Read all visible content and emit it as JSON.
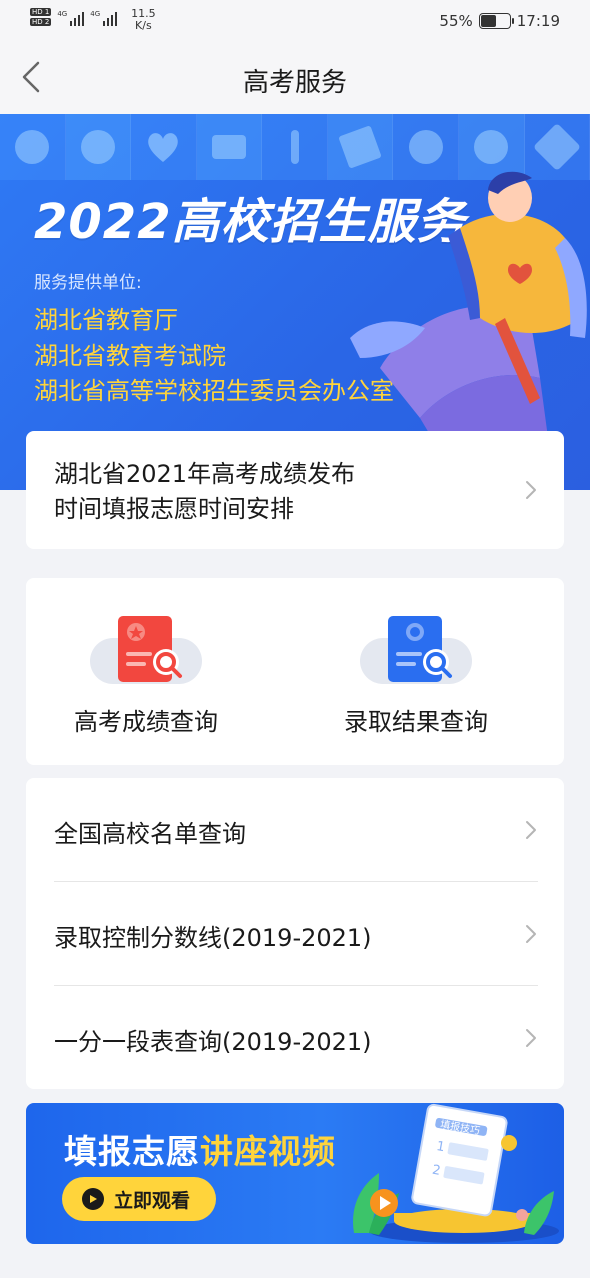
{
  "status_bar": {
    "sim1": "HD 1",
    "sim2": "HD 2",
    "network1": "4G",
    "network2": "4G",
    "speed_value": "11.5",
    "speed_unit": "K/s",
    "battery": "55%",
    "time": "17:19"
  },
  "nav": {
    "title": "高考服务",
    "back_icon": "chevron-left-icon"
  },
  "banner": {
    "title": "2022高校招生服务",
    "subtitle": "服务提供单位:",
    "providers": [
      "湖北省教育厅",
      "湖北省教育考试院",
      "湖北省高等学校招生委员会办公室"
    ],
    "colors": {
      "background": "#2a6ef0",
      "highlight": "#ffd43b"
    }
  },
  "notice": {
    "line1": "湖北省2021年高考成绩发布",
    "line2": "时间填报志愿时间安排"
  },
  "quick": {
    "items": [
      {
        "label": "高考成绩查询",
        "icon": "score-report-icon",
        "color": "#f2473f"
      },
      {
        "label": "录取结果查询",
        "icon": "admission-certificate-icon",
        "color": "#2a6ef0"
      }
    ]
  },
  "list": {
    "items": [
      {
        "label": "全国高校名单查询"
      },
      {
        "label": "录取控制分数线(2019-2021)"
      },
      {
        "label": "一分一段表查询(2019-2021)"
      }
    ]
  },
  "video": {
    "title_part1": "填报志愿",
    "title_part2": "讲座视频",
    "button_label": "立即观看",
    "book_title": "填报技巧",
    "book_item1": "1",
    "book_item2": "2"
  }
}
